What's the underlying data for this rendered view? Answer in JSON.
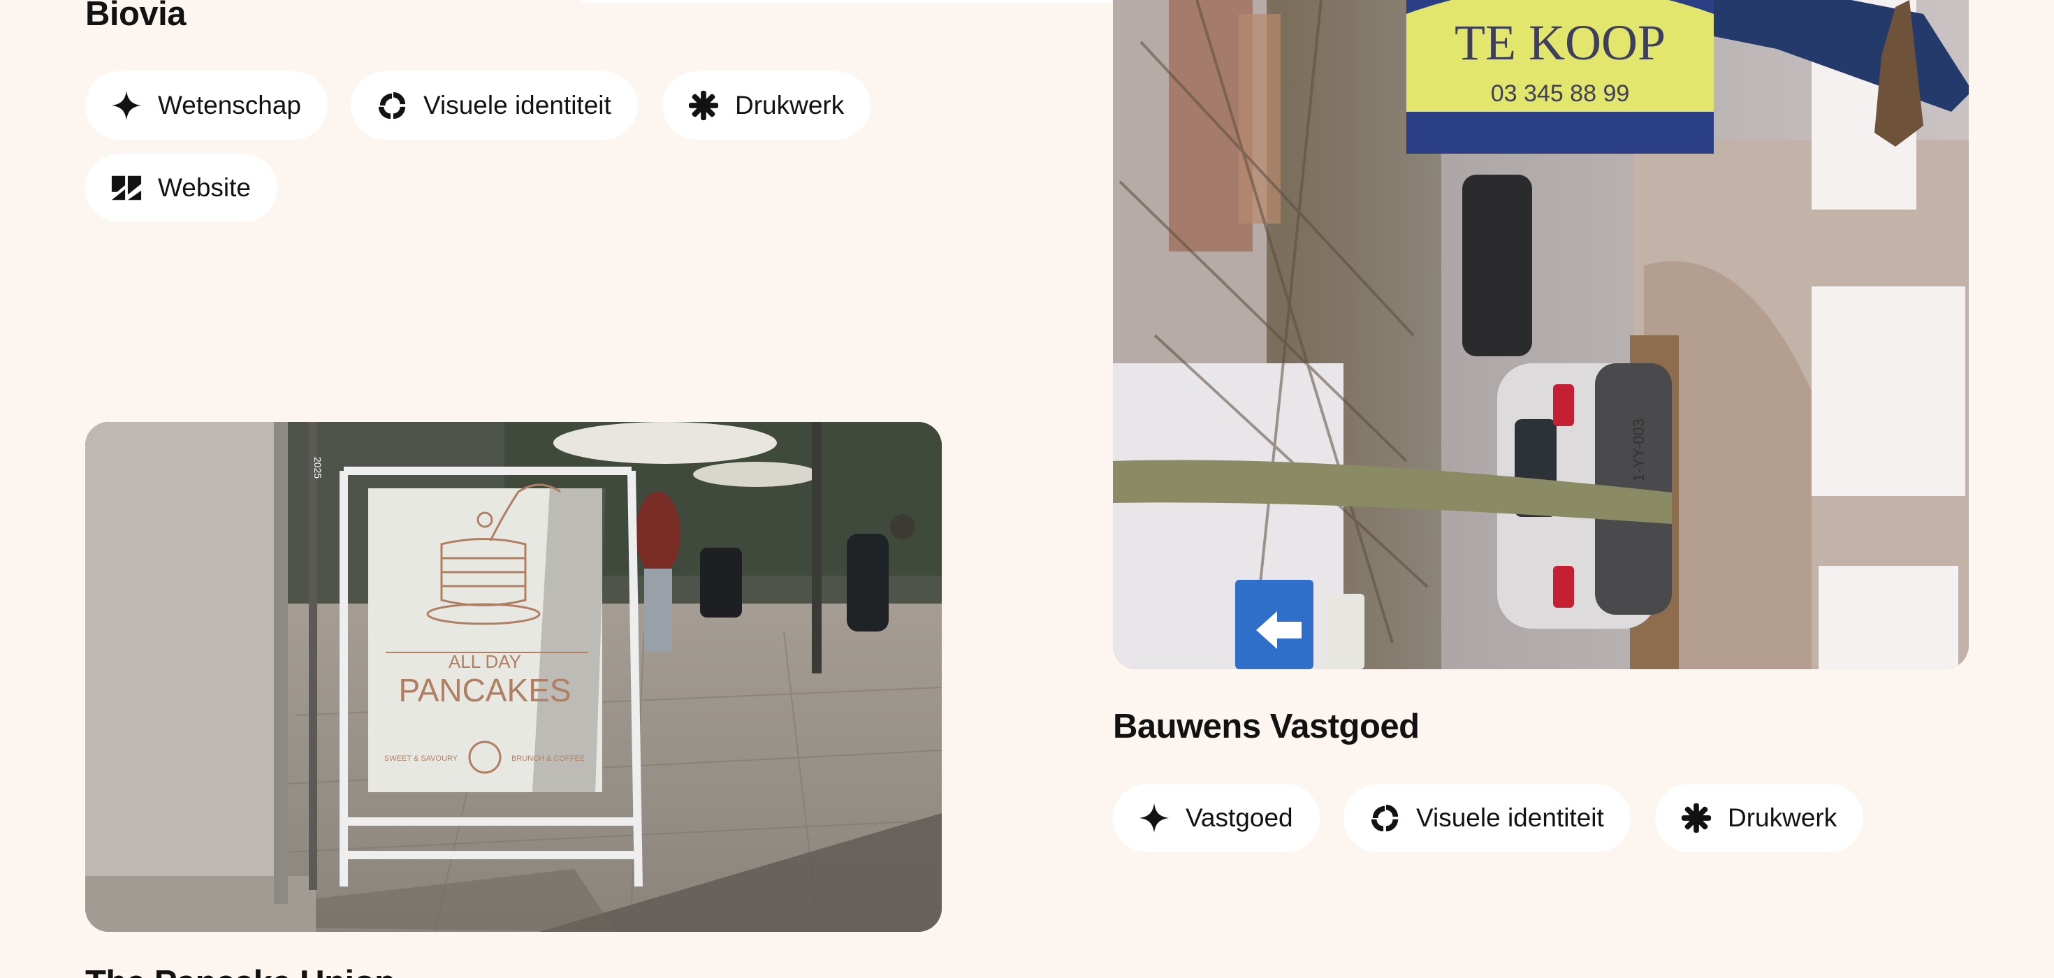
{
  "projects": [
    {
      "title": "Biovia",
      "tags": [
        {
          "label": "Wetenschap",
          "icon": "sparkle-icon"
        },
        {
          "label": "Visuele identiteit",
          "icon": "swirl-icon"
        },
        {
          "label": "Drukwerk",
          "icon": "starburst-icon"
        },
        {
          "label": "Website",
          "icon": "website-logo-icon"
        }
      ]
    },
    {
      "title": "Bauwens Vastgoed",
      "image": {
        "sign_title": "TE KOOP",
        "sign_phone": "03 345 88 99",
        "plate": "1-YY-003"
      },
      "tags": [
        {
          "label": "Vastgoed",
          "icon": "sparkle-icon"
        },
        {
          "label": "Visuele identiteit",
          "icon": "swirl-icon"
        },
        {
          "label": "Drukwerk",
          "icon": "starburst-icon"
        }
      ]
    },
    {
      "title": "The Pancake Union",
      "image": {
        "sign_line1": "ALL DAY",
        "sign_line2": "PANCAKES",
        "sign_left": "SWEET & SAVOURY",
        "sign_right": "BRUNCH & COFFEE",
        "pole_tag": "2025"
      }
    }
  ],
  "colors": {
    "background": "#fdf6f0",
    "tag_background": "#ffffff",
    "text": "#121212",
    "sign_yellow": "#e3e66c",
    "sign_blue": "#2b3f86",
    "pancake_ink": "#b07f63"
  }
}
